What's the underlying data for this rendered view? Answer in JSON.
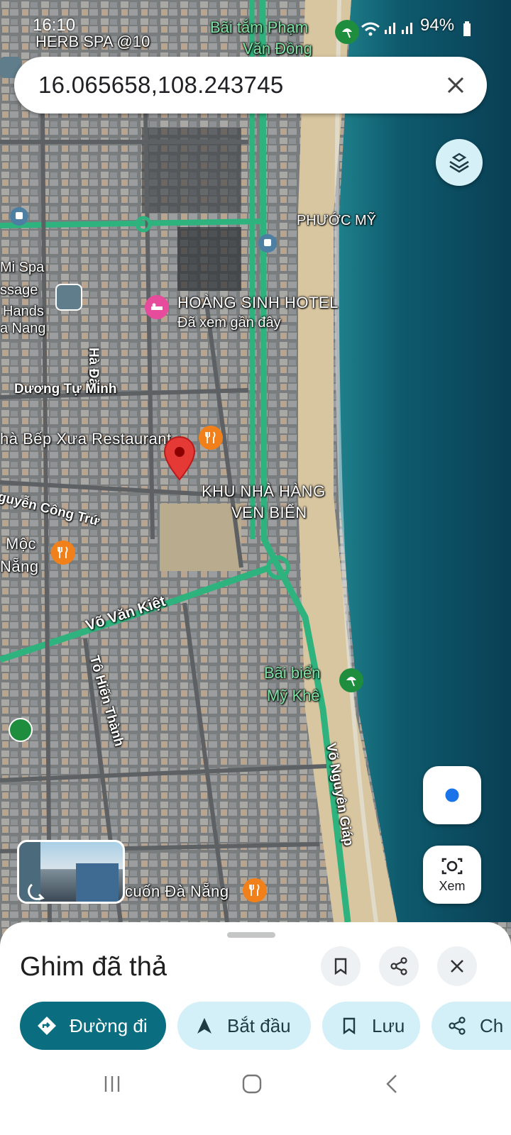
{
  "status_bar": {
    "time": "16:10",
    "battery": "94%"
  },
  "search": {
    "value": "16.065658,108.243745"
  },
  "map": {
    "labels": {
      "herb_spa": "HERB SPA @10",
      "bai_tam_1": "Bãi tắm Phạm",
      "bai_tam_2": "Văn Đồng",
      "phuoc_my": "PHƯỚC MỸ",
      "mi_spa": "Mi Spa",
      "ssage": "ssage",
      "hands": "Hands",
      "a_nang": "a Nang",
      "hoang_sinh": "HOÀNG SINH HOTEL",
      "recently_viewed": "Đã xem gần đây",
      "ha_dac": "Hà Đặc",
      "duong_tu_minh": "Dương Tự Minh",
      "nha_bep_xua": "hà Bếp Xưa Restaurant",
      "khu_nha_hang_1": "KHU NHÀ HÀNG",
      "khu_nha_hang_2": "VEN BIỂN",
      "nguyen_cong_tru": "guyễn Công Trứ",
      "moc": "Mộc",
      "nang": "Nẵng",
      "vo_van_kiet": "Võ Văn Kiệt",
      "to_hien_thanh": "Tô Hiến Thành",
      "bai_bien_1": "Bãi biển",
      "bai_bien_2": "Mỹ Khê",
      "vo_nguyen_giap": "Võ Nguyên Giáp",
      "cuon_da_nang": "cuốn Đà Nẵng"
    }
  },
  "lens_button": {
    "label": "Xem"
  },
  "sheet": {
    "title": "Ghim đã thả",
    "chips": {
      "directions": "Đường đi",
      "start": "Bắt đầu",
      "save": "Lưu",
      "share": "Ch"
    }
  },
  "colors": {
    "accent": "#0b6e80",
    "chip_bg": "#d3f0f8",
    "road": "#2fb37e",
    "water": "#0a4f63",
    "pin_red": "#e53935"
  },
  "icons": [
    "wifi-icon",
    "signal-icon",
    "battery-icon",
    "close-icon",
    "layers-icon",
    "bus-icon",
    "hotel-icon",
    "restaurant-icon",
    "beach-icon",
    "pin-icon",
    "location-icon",
    "lens-icon",
    "bookmark-icon",
    "share-icon",
    "directions-icon",
    "navigation-icon"
  ]
}
